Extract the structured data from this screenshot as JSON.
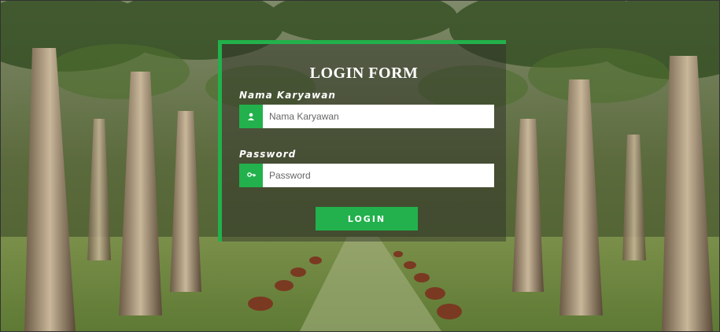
{
  "form": {
    "title": "LOGIN FORM",
    "name_label": "Nama Karyawan",
    "name_placeholder": "Nama Karyawan",
    "name_value": "",
    "name_icon": "user-icon",
    "password_label": "Password",
    "password_placeholder": "Password",
    "password_value": "",
    "password_icon": "key-icon",
    "login_label": "LOGIN"
  },
  "colors": {
    "accent": "#22b14c",
    "panel_overlay": "rgba(45,45,40,0.45)"
  }
}
